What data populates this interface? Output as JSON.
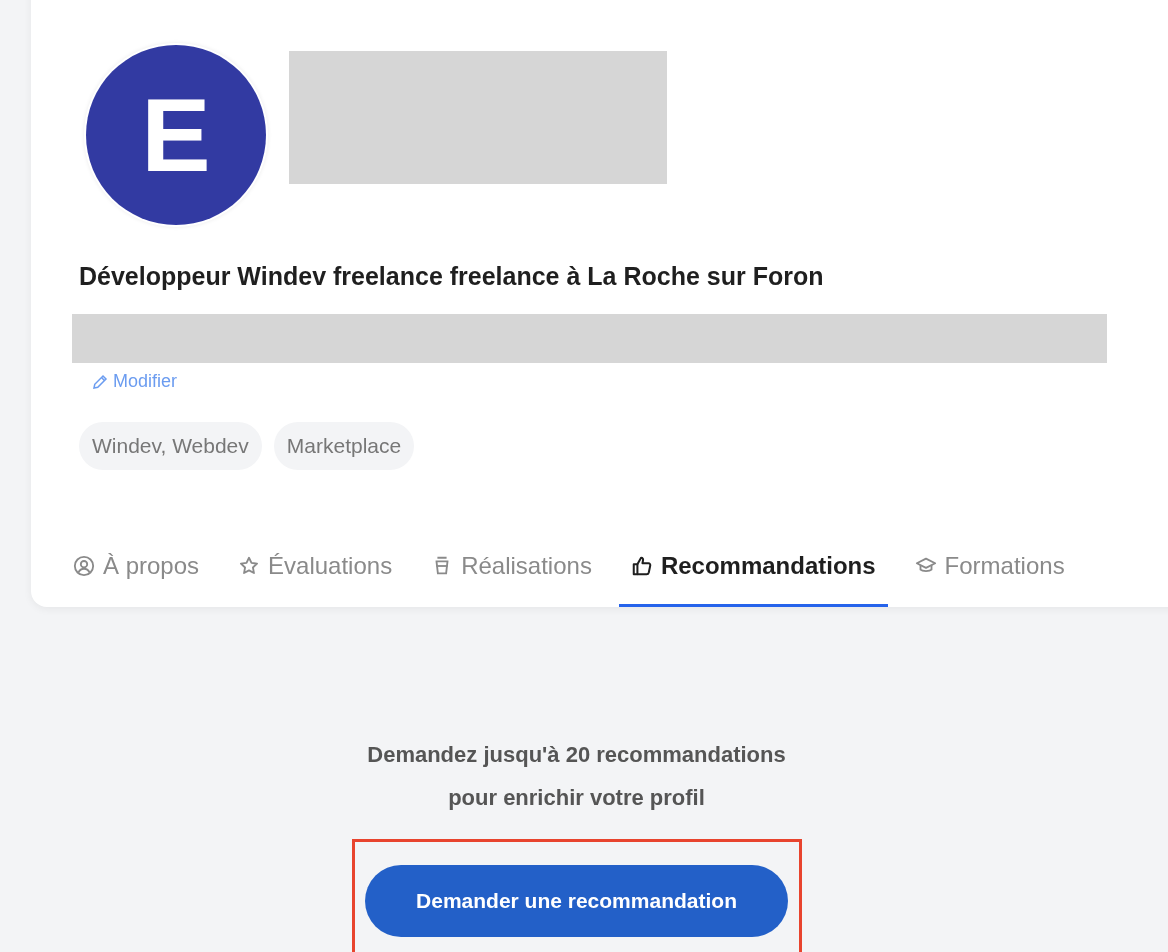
{
  "profile": {
    "avatar_initial": "E",
    "headline": "Développeur Windev freelance freelance à La Roche sur Foron",
    "edit_link": "Modifier",
    "tags": [
      "Windev, Webdev",
      "Marketplace"
    ]
  },
  "tabs": [
    {
      "label": "À propos",
      "selected": false
    },
    {
      "label": "Évaluations",
      "selected": false
    },
    {
      "label": "Réalisations",
      "selected": false
    },
    {
      "label": "Recommandations",
      "selected": true
    },
    {
      "label": "Formations",
      "selected": false
    }
  ],
  "recommendations": {
    "message": [
      "Demandez jusqu'à 20 recommandations",
      "pour enrichir votre profil"
    ],
    "button": "Demander une recommandation",
    "highlighted": true
  }
}
